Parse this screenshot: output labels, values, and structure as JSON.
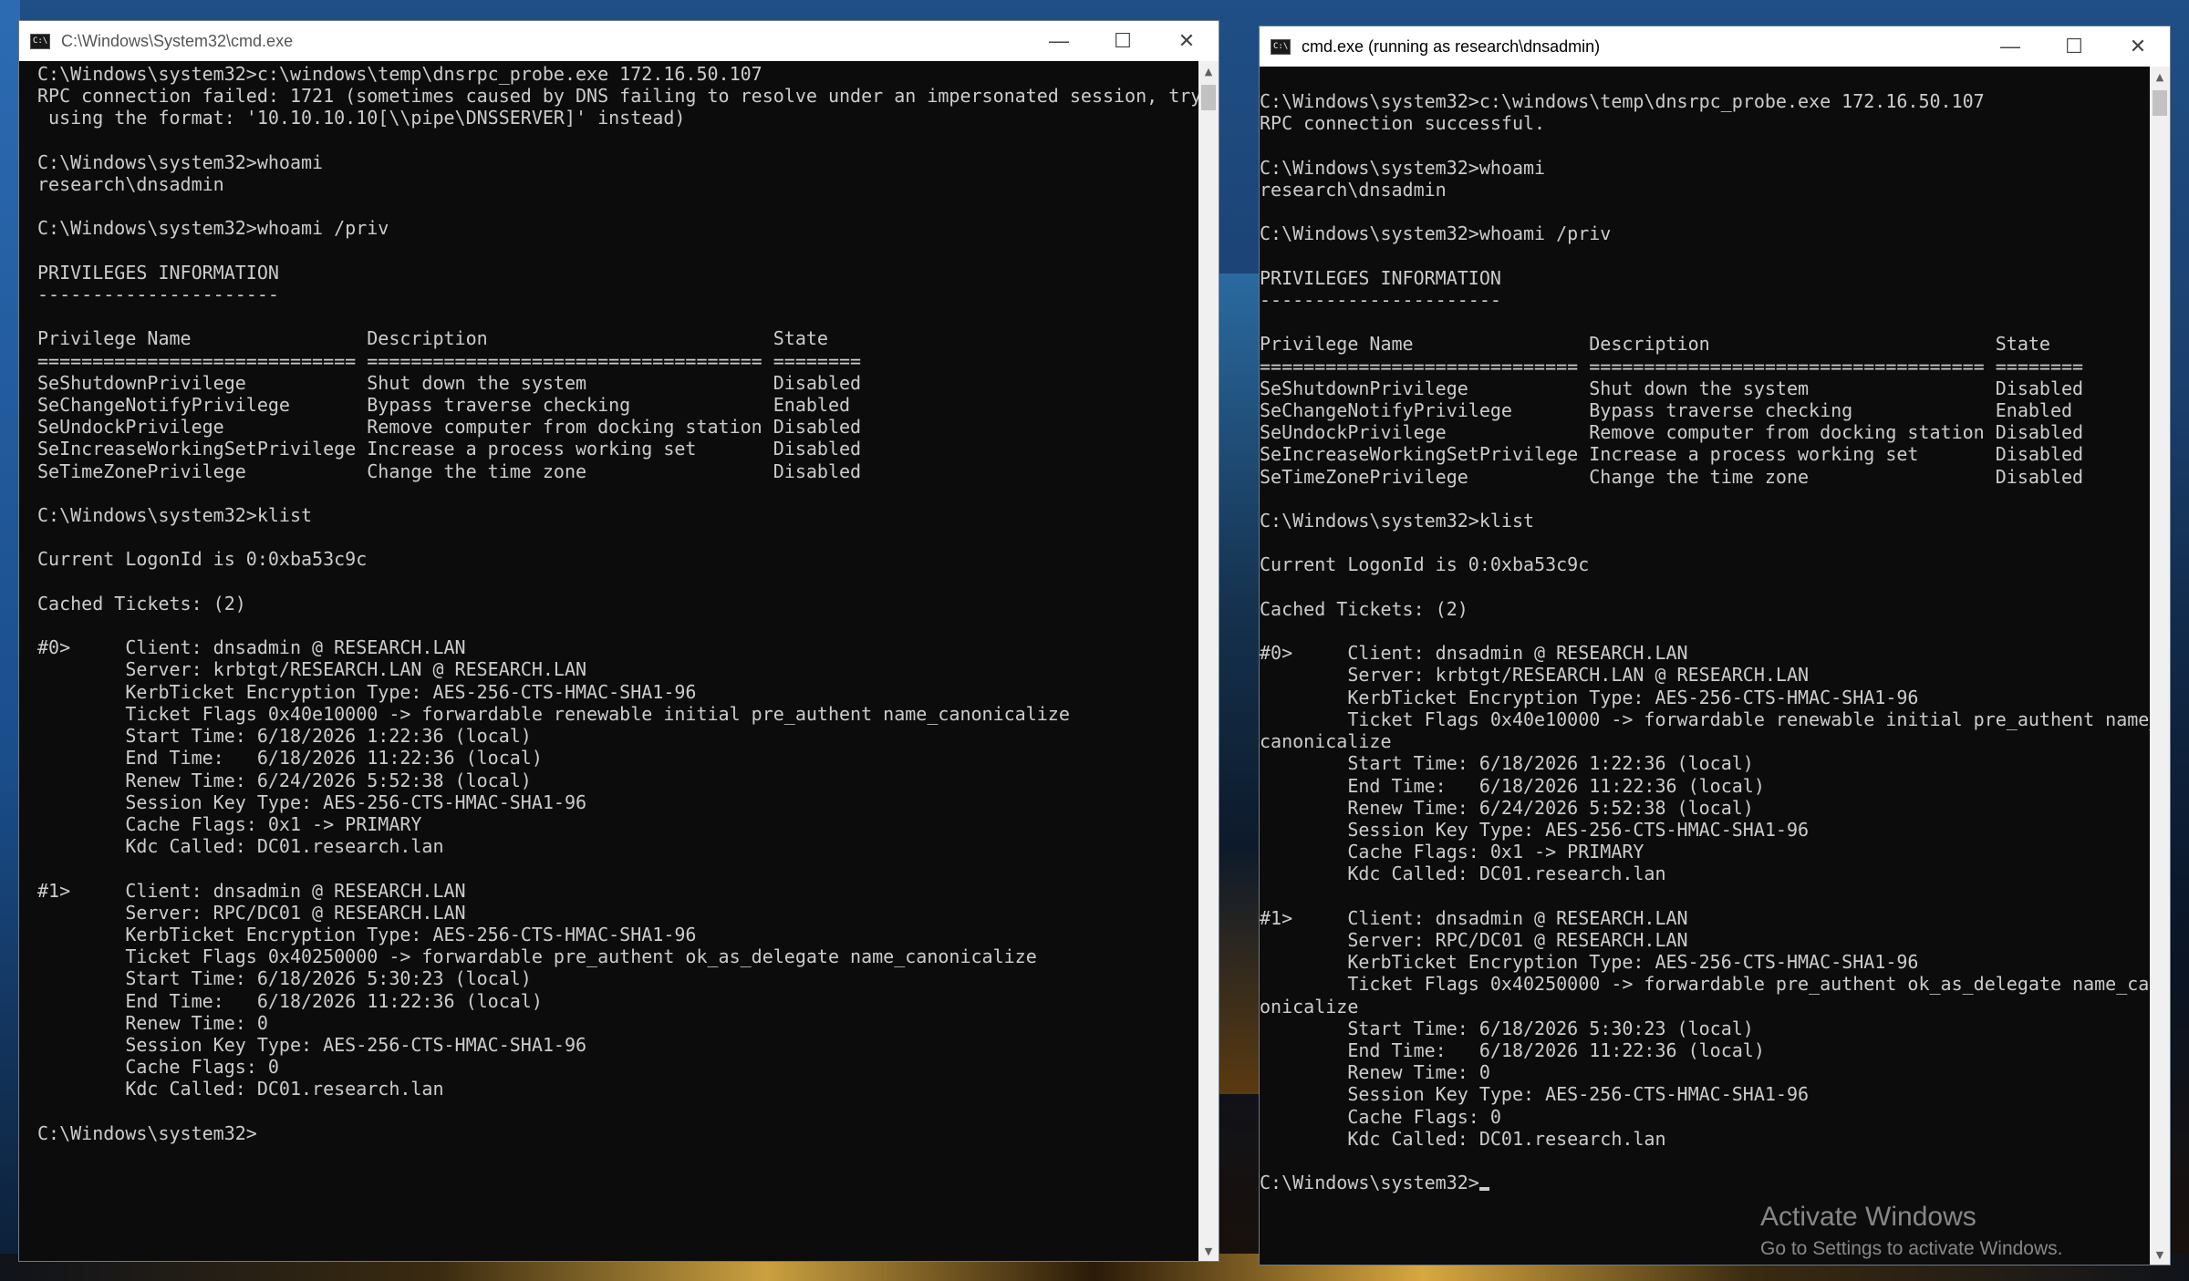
{
  "windows": [
    {
      "title": "C:\\Windows\\System32\\cmd.exe",
      "controls": {
        "minimize": "—",
        "maximize": "☐",
        "close": "✕"
      },
      "lines": [
        "C:\\Windows\\system32>c:\\windows\\temp\\dnsrpc_probe.exe 172.16.50.107",
        "RPC connection failed: 1721 (sometimes caused by DNS failing to resolve under an impersonated session, try",
        " using the format: '10.10.10.10[\\\\pipe\\DNSSERVER]' instead)",
        "",
        "C:\\Windows\\system32>whoami",
        "research\\dnsadmin",
        "",
        "C:\\Windows\\system32>whoami /priv",
        "",
        "PRIVILEGES INFORMATION",
        "----------------------",
        "",
        "Privilege Name                Description                          State",
        "============================= ==================================== ========",
        "SeShutdownPrivilege           Shut down the system                 Disabled",
        "SeChangeNotifyPrivilege       Bypass traverse checking             Enabled",
        "SeUndockPrivilege             Remove computer from docking station Disabled",
        "SeIncreaseWorkingSetPrivilege Increase a process working set       Disabled",
        "SeTimeZonePrivilege           Change the time zone                 Disabled",
        "",
        "C:\\Windows\\system32>klist",
        "",
        "Current LogonId is 0:0xba53c9c",
        "",
        "Cached Tickets: (2)",
        "",
        "#0>     Client: dnsadmin @ RESEARCH.LAN",
        "        Server: krbtgt/RESEARCH.LAN @ RESEARCH.LAN",
        "        KerbTicket Encryption Type: AES-256-CTS-HMAC-SHA1-96",
        "        Ticket Flags 0x40e10000 -> forwardable renewable initial pre_authent name_canonicalize",
        "        Start Time: 6/18/2026 1:22:36 (local)",
        "        End Time:   6/18/2026 11:22:36 (local)",
        "        Renew Time: 6/24/2026 5:52:38 (local)",
        "        Session Key Type: AES-256-CTS-HMAC-SHA1-96",
        "        Cache Flags: 0x1 -> PRIMARY",
        "        Kdc Called: DC01.research.lan",
        "",
        "#1>     Client: dnsadmin @ RESEARCH.LAN",
        "        Server: RPC/DC01 @ RESEARCH.LAN",
        "        KerbTicket Encryption Type: AES-256-CTS-HMAC-SHA1-96",
        "        Ticket Flags 0x40250000 -> forwardable pre_authent ok_as_delegate name_canonicalize",
        "        Start Time: 6/18/2026 5:30:23 (local)",
        "        End Time:   6/18/2026 11:22:36 (local)",
        "        Renew Time: 0",
        "        Session Key Type: AES-256-CTS-HMAC-SHA1-96",
        "        Cache Flags: 0",
        "        Kdc Called: DC01.research.lan",
        "",
        "C:\\Windows\\system32>"
      ]
    },
    {
      "title": "cmd.exe (running as research\\dnsadmin)",
      "controls": {
        "minimize": "—",
        "maximize": "☐",
        "close": "✕"
      },
      "lines": [
        "",
        "C:\\Windows\\system32>c:\\windows\\temp\\dnsrpc_probe.exe 172.16.50.107",
        "RPC connection successful.",
        "",
        "C:\\Windows\\system32>whoami",
        "research\\dnsadmin",
        "",
        "C:\\Windows\\system32>whoami /priv",
        "",
        "PRIVILEGES INFORMATION",
        "----------------------",
        "",
        "Privilege Name                Description                          State",
        "============================= ==================================== ========",
        "SeShutdownPrivilege           Shut down the system                 Disabled",
        "SeChangeNotifyPrivilege       Bypass traverse checking             Enabled",
        "SeUndockPrivilege             Remove computer from docking station Disabled",
        "SeIncreaseWorkingSetPrivilege Increase a process working set       Disabled",
        "SeTimeZonePrivilege           Change the time zone                 Disabled",
        "",
        "C:\\Windows\\system32>klist",
        "",
        "Current LogonId is 0:0xba53c9c",
        "",
        "Cached Tickets: (2)",
        "",
        "#0>     Client: dnsadmin @ RESEARCH.LAN",
        "        Server: krbtgt/RESEARCH.LAN @ RESEARCH.LAN",
        "        KerbTicket Encryption Type: AES-256-CTS-HMAC-SHA1-96",
        "        Ticket Flags 0x40e10000 -> forwardable renewable initial pre_authent name_",
        "canonicalize",
        "        Start Time: 6/18/2026 1:22:36 (local)",
        "        End Time:   6/18/2026 11:22:36 (local)",
        "        Renew Time: 6/24/2026 5:52:38 (local)",
        "        Session Key Type: AES-256-CTS-HMAC-SHA1-96",
        "        Cache Flags: 0x1 -> PRIMARY",
        "        Kdc Called: DC01.research.lan",
        "",
        "#1>     Client: dnsadmin @ RESEARCH.LAN",
        "        Server: RPC/DC01 @ RESEARCH.LAN",
        "        KerbTicket Encryption Type: AES-256-CTS-HMAC-SHA1-96",
        "        Ticket Flags 0x40250000 -> forwardable pre_authent ok_as_delegate name_can",
        "onicalize",
        "        Start Time: 6/18/2026 5:30:23 (local)",
        "        End Time:   6/18/2026 11:22:36 (local)",
        "        Renew Time: 0",
        "        Session Key Type: AES-256-CTS-HMAC-SHA1-96",
        "        Cache Flags: 0",
        "        Kdc Called: DC01.research.lan",
        "",
        "C:\\Windows\\system32>"
      ]
    }
  ],
  "watermark": {
    "title": "Activate Windows",
    "subtitle": "Go to Settings to activate Windows."
  },
  "colors": {
    "console_bg": "#0c0c0c",
    "console_text": "#cccccc",
    "titlebar_bg": "#ffffff"
  },
  "icons": {
    "app": "cmd-console-icon",
    "minimize": "minimize-icon",
    "maximize": "maximize-icon",
    "close": "close-icon"
  }
}
